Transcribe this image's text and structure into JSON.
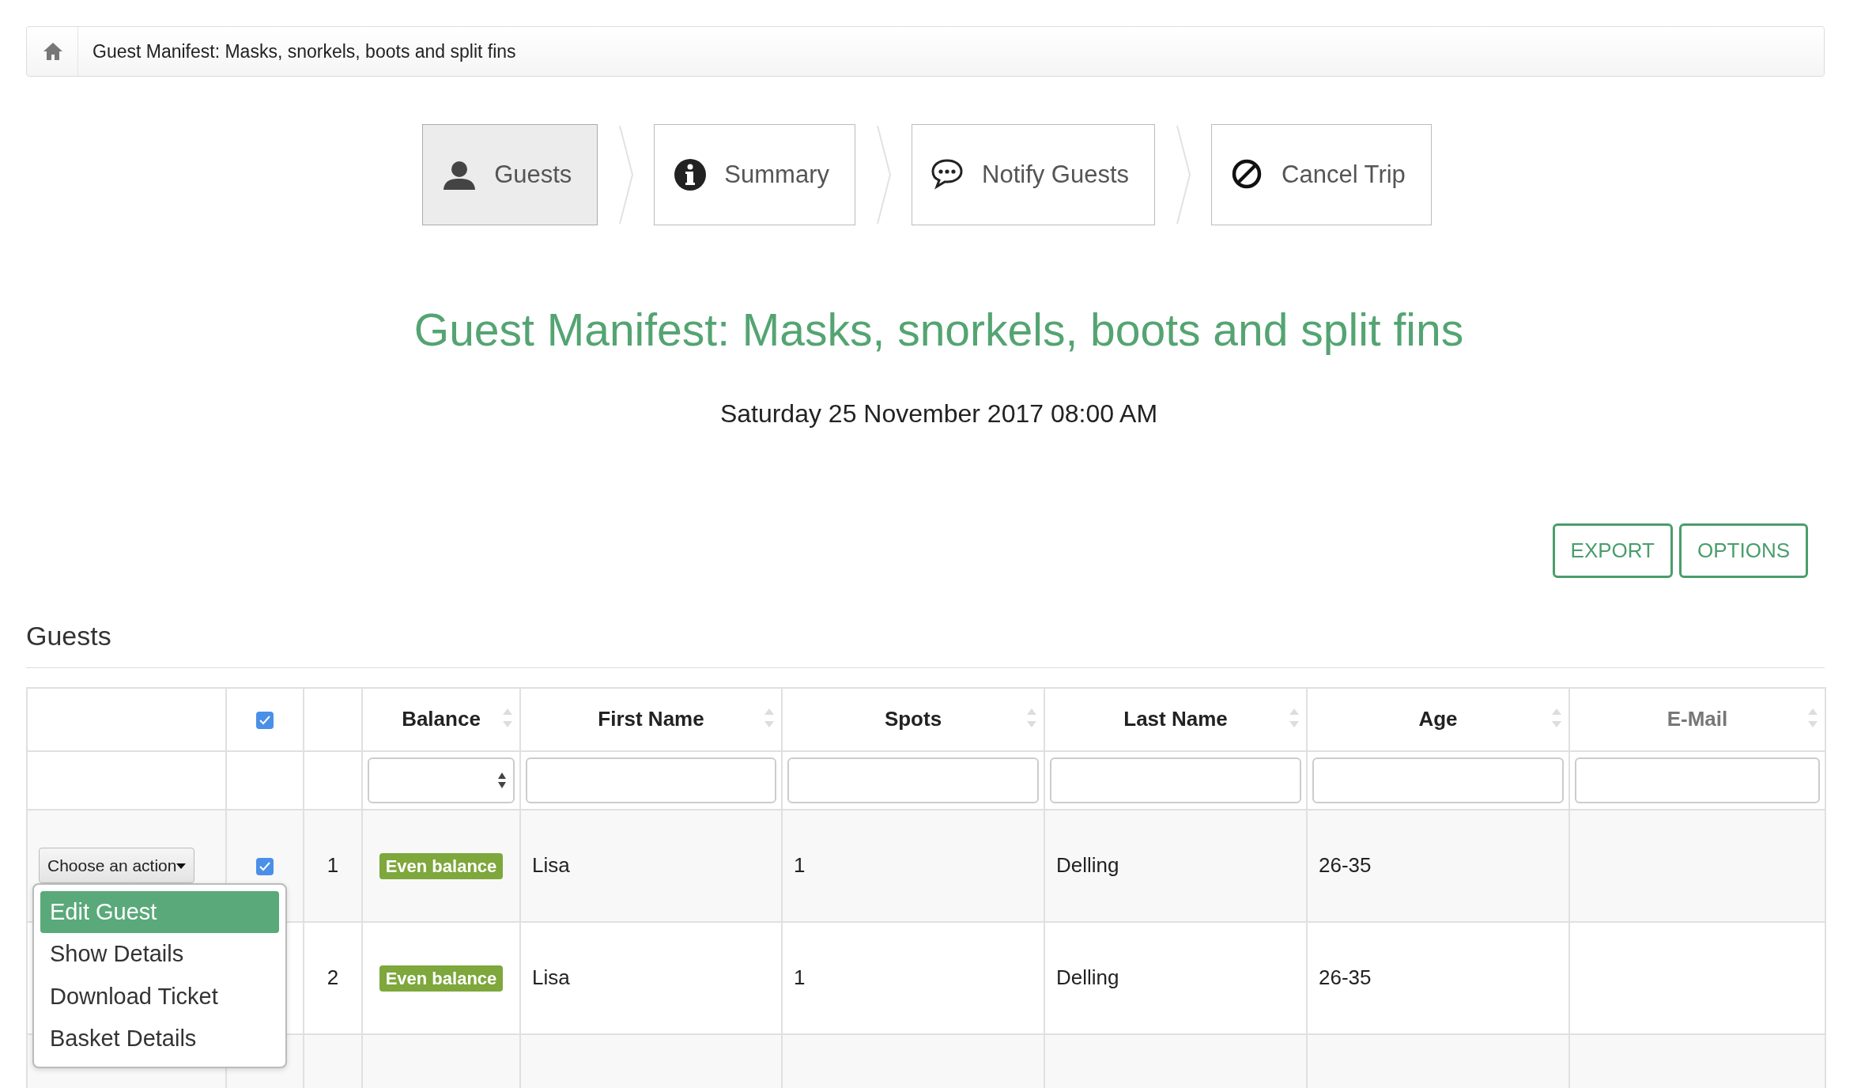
{
  "breadcrumb": {
    "current": "Guest Manifest: Masks, snorkels, boots and split fins"
  },
  "steps": [
    {
      "label": "Guests",
      "selected": true
    },
    {
      "label": "Summary",
      "selected": false
    },
    {
      "label": "Notify Guests",
      "selected": false
    },
    {
      "label": "Cancel Trip",
      "selected": false
    }
  ],
  "title": "Guest Manifest: Masks, snorkels, boots and split fins",
  "date": "Saturday 25 November 2017 08:00 AM",
  "buttons": [
    "EXPORT",
    "OPTIONS"
  ],
  "section": "Guests",
  "table": {
    "select_all_checked": true,
    "columns": [
      {
        "label": "Balance"
      },
      {
        "label": "First Name"
      },
      {
        "label": "Spots"
      },
      {
        "label": "Last Name"
      },
      {
        "label": "Age"
      },
      {
        "label": "E-Mail"
      }
    ],
    "rows": [
      {
        "action": "Choose an action",
        "checked": true,
        "number": "1",
        "balance": "Even balance",
        "first_name": "Lisa",
        "spots": "1",
        "last_name": "Delling",
        "age": "26-35"
      },
      {
        "number": "2",
        "balance": "Even balance",
        "first_name": "Lisa",
        "spots": "1",
        "last_name": "Delling",
        "age": "26-35"
      }
    ]
  },
  "action_menu": [
    {
      "label": "Edit Guest",
      "selected": true
    },
    {
      "label": "Show Details",
      "selected": false
    },
    {
      "label": "Download Ticket",
      "selected": false
    },
    {
      "label": "Basket Details",
      "selected": false
    }
  ]
}
